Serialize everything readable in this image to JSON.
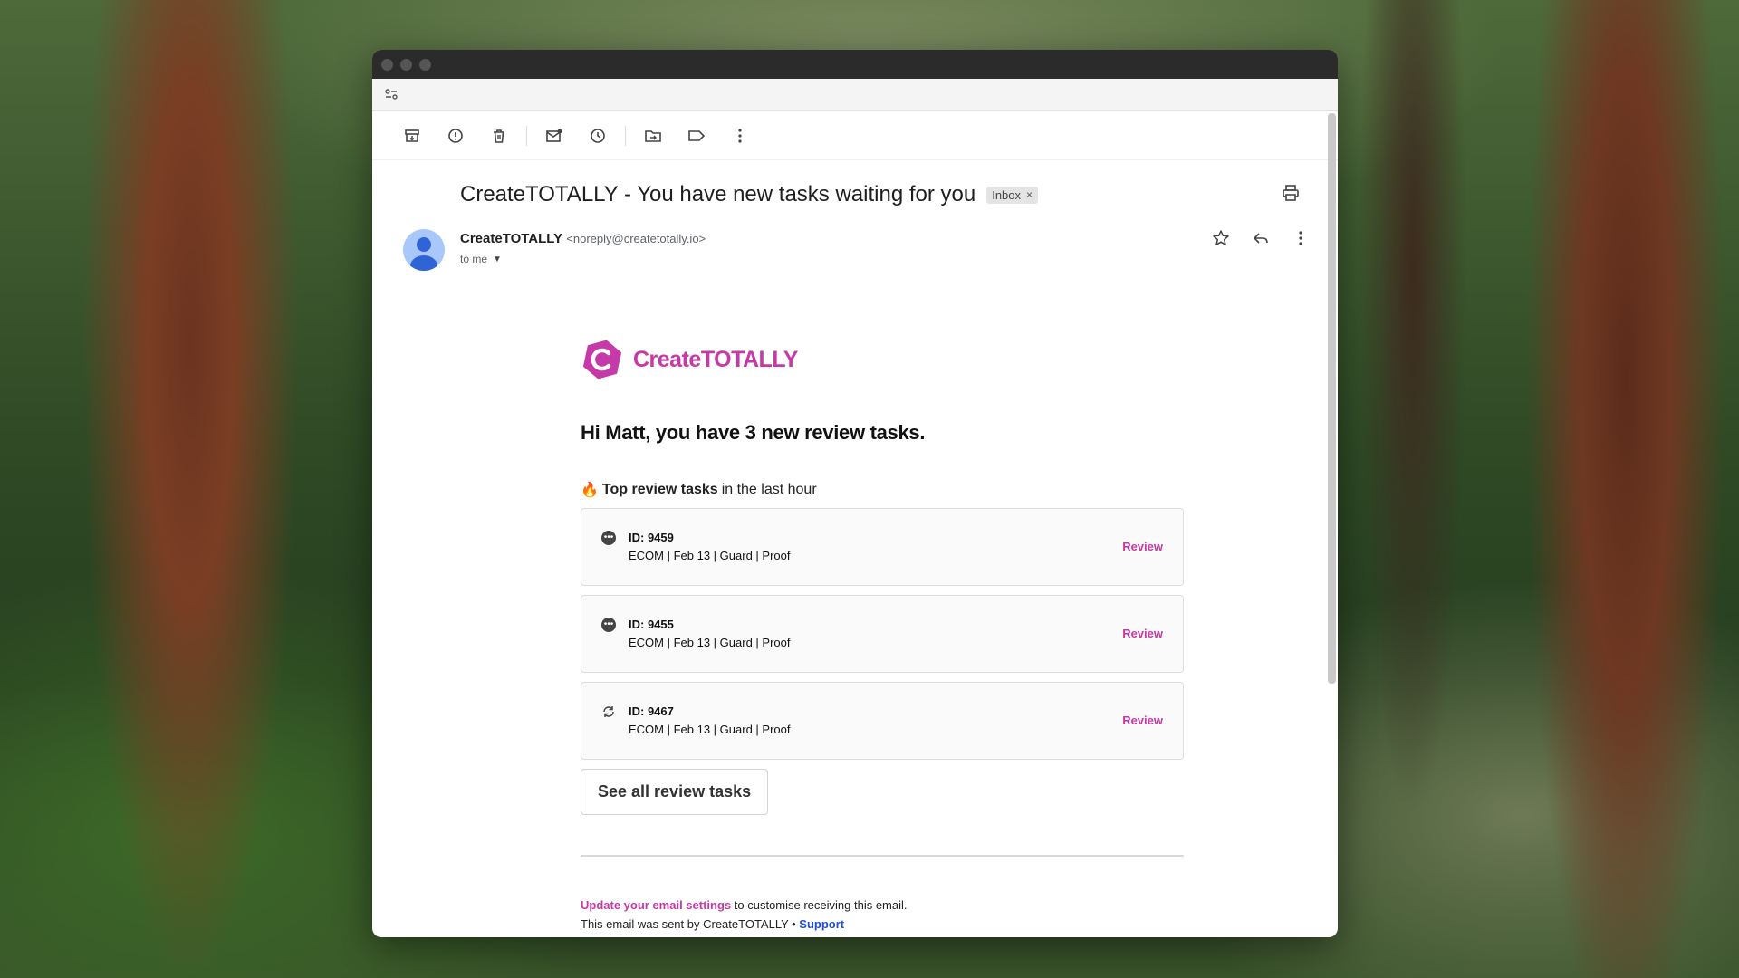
{
  "colors": {
    "brand": "#c53aa8",
    "support_link": "#1d4ed8"
  },
  "toolbar": {
    "icons": [
      "archive-icon",
      "report-spam-icon",
      "delete-icon",
      "mark-unread-icon",
      "snooze-icon",
      "move-to-icon",
      "label-icon",
      "more-vert-icon"
    ]
  },
  "email": {
    "subject": "CreateTOTALLY - You have new tasks waiting for you",
    "label_chip": "Inbox",
    "sender_name": "CreateTOTALLY",
    "sender_email": "<noreply@createtotally.io>",
    "recipient": "to me"
  },
  "body": {
    "brand_name": "CreateTOTALLY",
    "greeting": "Hi Matt, you have 3 new review tasks.",
    "top_tasks_emoji": "🔥",
    "top_tasks_bold": "Top review tasks",
    "top_tasks_rest": "in the last hour",
    "tasks": [
      {
        "id": "ID: 9459",
        "meta": "ECOM | Feb 13 | Guard | Proof",
        "action": "Review",
        "icon": "pending-icon"
      },
      {
        "id": "ID: 9455",
        "meta": "ECOM | Feb 13 | Guard | Proof",
        "action": "Review",
        "icon": "pending-icon"
      },
      {
        "id": "ID: 9467",
        "meta": "ECOM | Feb 13 | Guard | Proof",
        "action": "Review",
        "icon": "sync-icon"
      }
    ],
    "see_all": "See all review tasks",
    "footer_settings_link": "Update your email settings",
    "footer_settings_rest": " to customise receiving this email.",
    "footer_sent_by": "This email was sent by CreateTOTALLY • ",
    "footer_support_link": "Support"
  }
}
